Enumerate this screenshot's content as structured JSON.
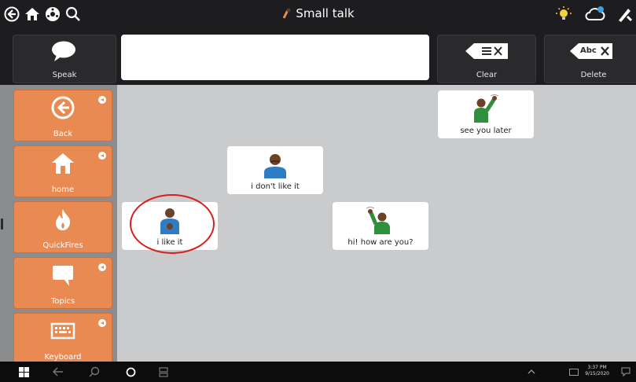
{
  "topbar": {
    "title": "Small talk",
    "left_icons": [
      "back-circle-icon",
      "home-icon",
      "settings-wheel-icon",
      "search-icon"
    ],
    "right_icons": [
      "lightbulb-icon",
      "cloud-sync-icon",
      "edit-tools-icon"
    ]
  },
  "toolbar": {
    "speak_label": "Speak",
    "clear_label": "Clear",
    "delete_label": "Delete",
    "delete_key_text": "Abc",
    "message_text": ""
  },
  "sidebar": {
    "items": [
      {
        "label": "Back",
        "icon": "back-arrow-icon"
      },
      {
        "label": "home",
        "icon": "home-icon"
      },
      {
        "label": "QuickFires",
        "icon": "fire-icon"
      },
      {
        "label": "Topics",
        "icon": "speech-bubble-icon"
      },
      {
        "label": "Keyboard",
        "icon": "keyboard-icon"
      }
    ]
  },
  "cards": {
    "see_you_later": "see you later",
    "dont_like_it": "i don't like it",
    "like_it": "i like it",
    "hi_how_are_you": "hi! how are you?"
  },
  "taskbar": {
    "time": "3:37 PM",
    "date": "9/15/2020"
  },
  "colors": {
    "sidebar_orange": "#e98a52",
    "dark_bar": "#1d1d1f",
    "grid_bg": "#c9cbcc",
    "highlight_circle": "#d62020"
  }
}
